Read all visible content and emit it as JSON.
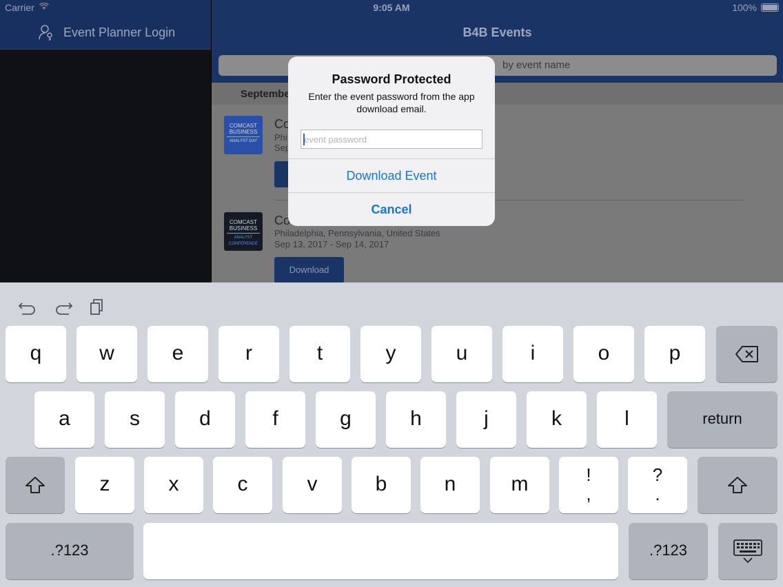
{
  "status_bar": {
    "carrier": "Carrier",
    "time": "9:05 AM",
    "battery": "100%"
  },
  "sidebar": {
    "login_label": "Event Planner Login"
  },
  "main": {
    "title": "B4B Events",
    "search_placeholder": "by event name",
    "section_header": "September",
    "events": [
      {
        "name": "Co",
        "location": "Phi",
        "dates": "Sep",
        "logo_lines": [
          "COMCAST",
          "BUSINESS",
          "ANALYST DAY"
        ],
        "logo_color": "#2a4fa8"
      },
      {
        "name": "Co",
        "location": "Philadelphia, Pennsylvania, United States",
        "dates": "Sep 13, 2017 - Sep 14, 2017",
        "download_label": "Download",
        "logo_lines": [
          "COMCAST",
          "BUSINESS",
          "ANALYST CONFERENCE"
        ],
        "logo_color": "#151a24"
      }
    ]
  },
  "alert": {
    "title": "Password Protected",
    "message": "Enter the event password from the app download email.",
    "field_placeholder": "event password",
    "field_value": "",
    "primary_action": "Download Event",
    "cancel_action": "Cancel"
  },
  "keyboard": {
    "row1": [
      "q",
      "w",
      "e",
      "r",
      "t",
      "y",
      "u",
      "i",
      "o",
      "p"
    ],
    "row2": [
      "a",
      "s",
      "d",
      "f",
      "g",
      "h",
      "j",
      "k",
      "l"
    ],
    "row3": [
      "z",
      "x",
      "c",
      "v",
      "b",
      "n",
      "m"
    ],
    "punct1": [
      "!",
      ","
    ],
    "punct2": [
      "?",
      "."
    ],
    "return_label": "return",
    "numbers_label": ".?123",
    "toolbar_icons": [
      "undo-icon",
      "redo-icon",
      "paste-icon"
    ],
    "colors": {
      "key": "#ffffff",
      "special_key": "#aeb3bc",
      "background": "#d2d5db"
    }
  },
  "colors": {
    "nav": "#1b3466",
    "link": "#1a73d9"
  }
}
